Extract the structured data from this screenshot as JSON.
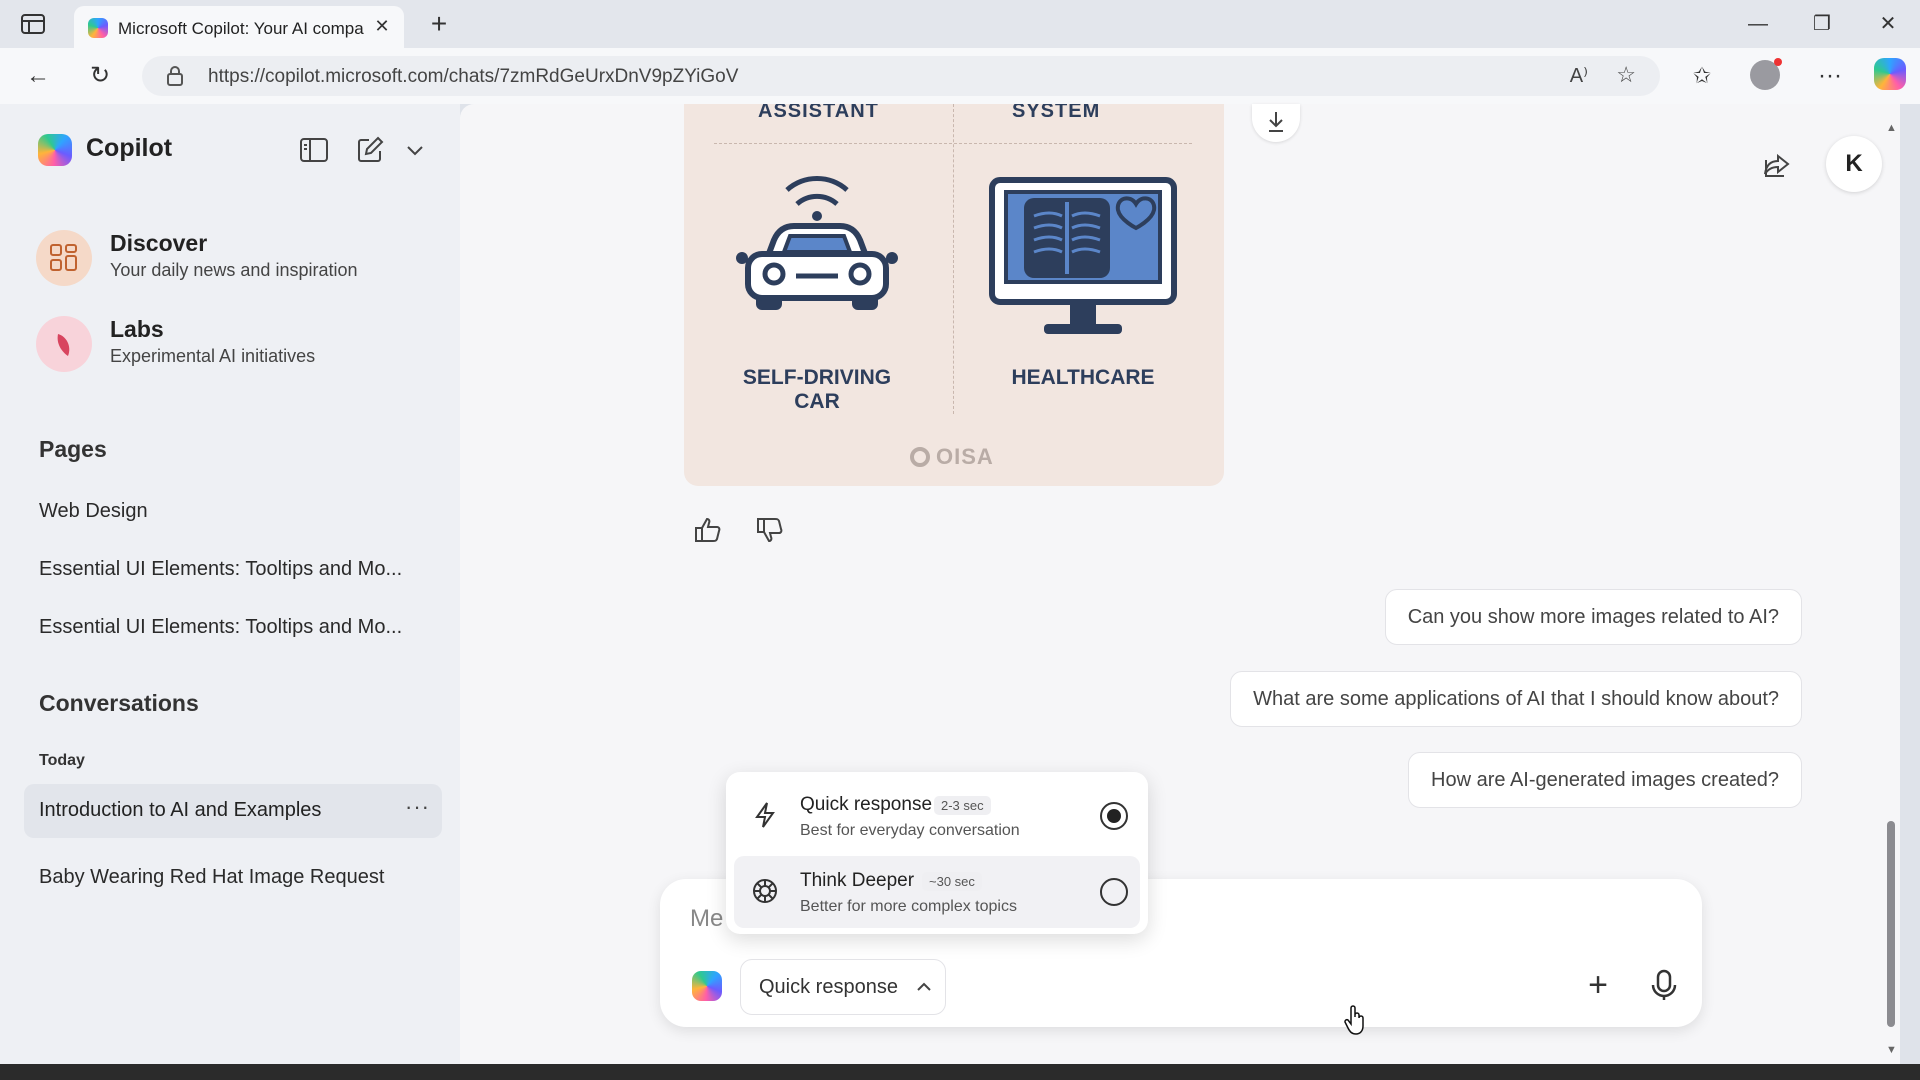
{
  "browser": {
    "tab_title": "Microsoft Copilot: Your AI compa",
    "url": "https://copilot.microsoft.com/chats/7zmRdGeUrxDnV9pZYiGoV"
  },
  "sidebar": {
    "brand": "Copilot",
    "discover": {
      "title": "Discover",
      "subtitle": "Your daily news and inspiration"
    },
    "labs": {
      "title": "Labs",
      "subtitle": "Experimental AI initiatives"
    },
    "pages_heading": "Pages",
    "pages": [
      "Web Design",
      "Essential UI Elements: Tooltips and Mo...",
      "Essential UI Elements: Tooltips and Mo..."
    ],
    "conversations_heading": "Conversations",
    "today_label": "Today",
    "conversations": [
      "Introduction to AI and Examples",
      "Baby Wearing Red Hat Image Request"
    ],
    "more_label": "···"
  },
  "image": {
    "top_left": "ASSISTANT",
    "top_right": "SYSTEM",
    "caption_left_1": "SELF-DRIVING",
    "caption_left_2": "CAR",
    "caption_right": "HEALTHCARE",
    "brand": "OISA"
  },
  "suggestions": [
    "Can you show more images related to AI?",
    "What are some applications of AI that I should know about?",
    "How are AI-generated images created?"
  ],
  "composer": {
    "placeholder": "Me",
    "mode_label": "Quick response"
  },
  "mode_menu": {
    "options": [
      {
        "name": "Quick response",
        "tag": "2-3 sec",
        "desc": "Best for everyday conversation",
        "selected": true
      },
      {
        "name": "Think Deeper",
        "tag": "~30 sec",
        "desc": "Better for more complex topics",
        "selected": false
      }
    ]
  },
  "user_initial": "K",
  "colors": {
    "illustration_ink": "#2d3e5c",
    "illustration_bg": "#f2e6e0",
    "accent": "#6b5cff"
  },
  "icons": [
    "sidebar-toggle-icon",
    "new-chat-icon",
    "chevron-down-icon",
    "discover-grid-icon",
    "labs-icon",
    "download-icon",
    "share-icon",
    "thumbs-up-icon",
    "thumbs-down-icon",
    "lightning-icon",
    "think-deeper-icon",
    "plus-icon",
    "microphone-icon"
  ]
}
